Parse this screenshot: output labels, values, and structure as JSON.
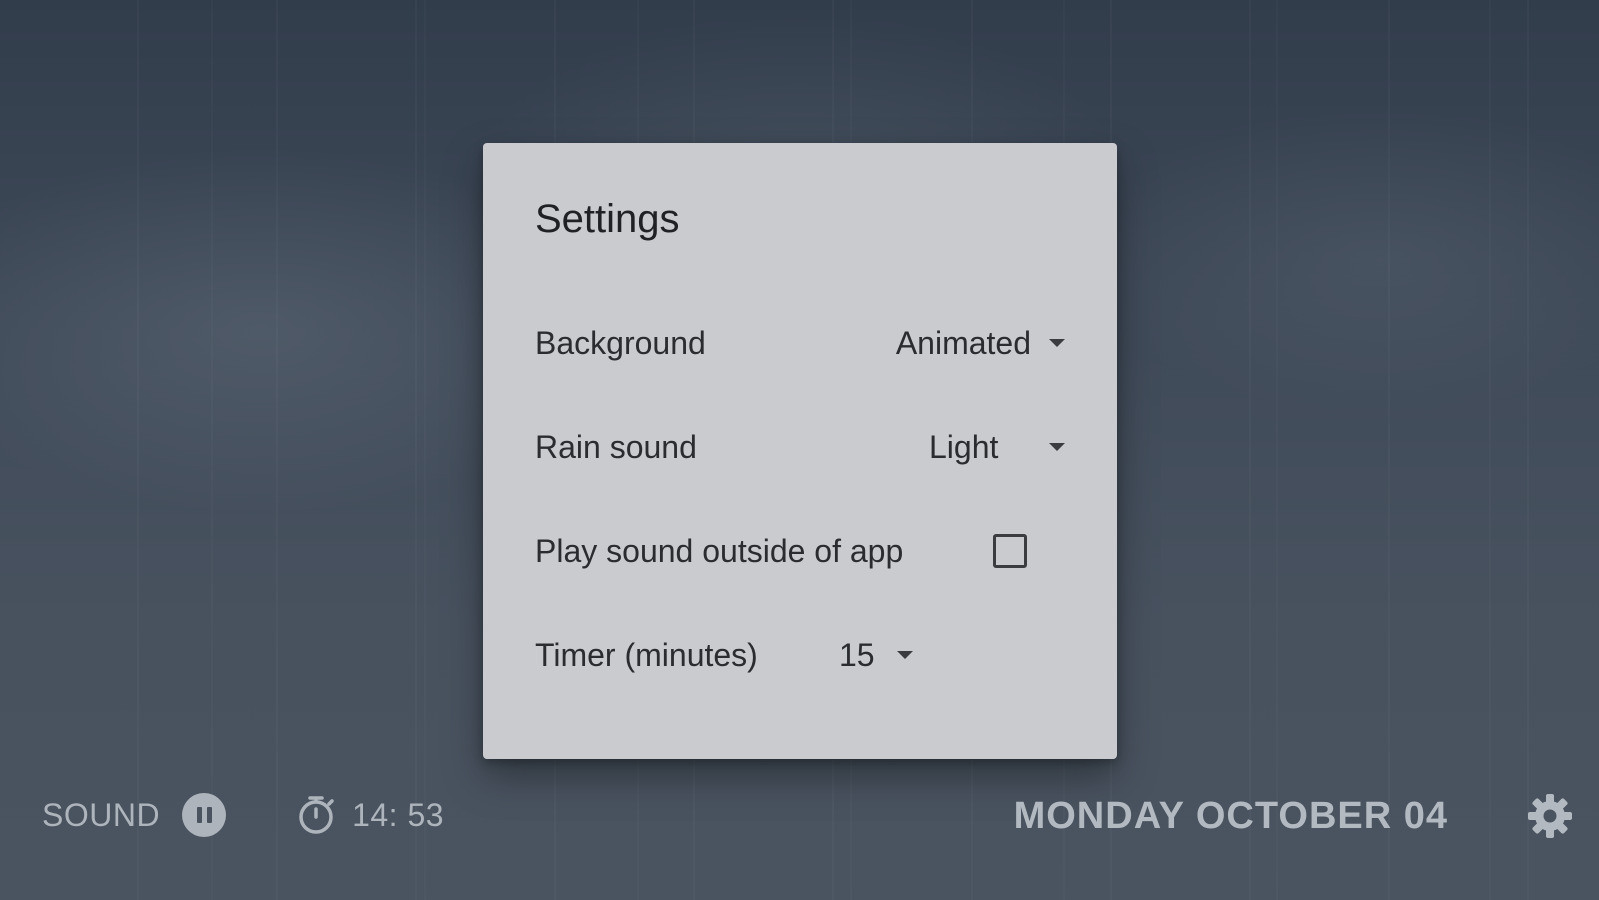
{
  "settings": {
    "title": "Settings",
    "background": {
      "label": "Background",
      "value": "Animated"
    },
    "rain_sound": {
      "label": "Rain sound",
      "value": "Light"
    },
    "play_outside": {
      "label": "Play sound outside of app",
      "checked": false
    },
    "timer": {
      "label": "Timer (minutes)",
      "value": "15"
    }
  },
  "footer": {
    "sound_label": "SOUND",
    "timer_value": "14: 53",
    "date": "MONDAY OCTOBER 04"
  },
  "icons": {
    "pause": "pause-icon",
    "stopwatch": "stopwatch-icon",
    "settings": "gear-icon"
  },
  "colors": {
    "background": "#3e4958",
    "dialog": "#c9cbce",
    "footer_text": "#aeb4bb"
  }
}
